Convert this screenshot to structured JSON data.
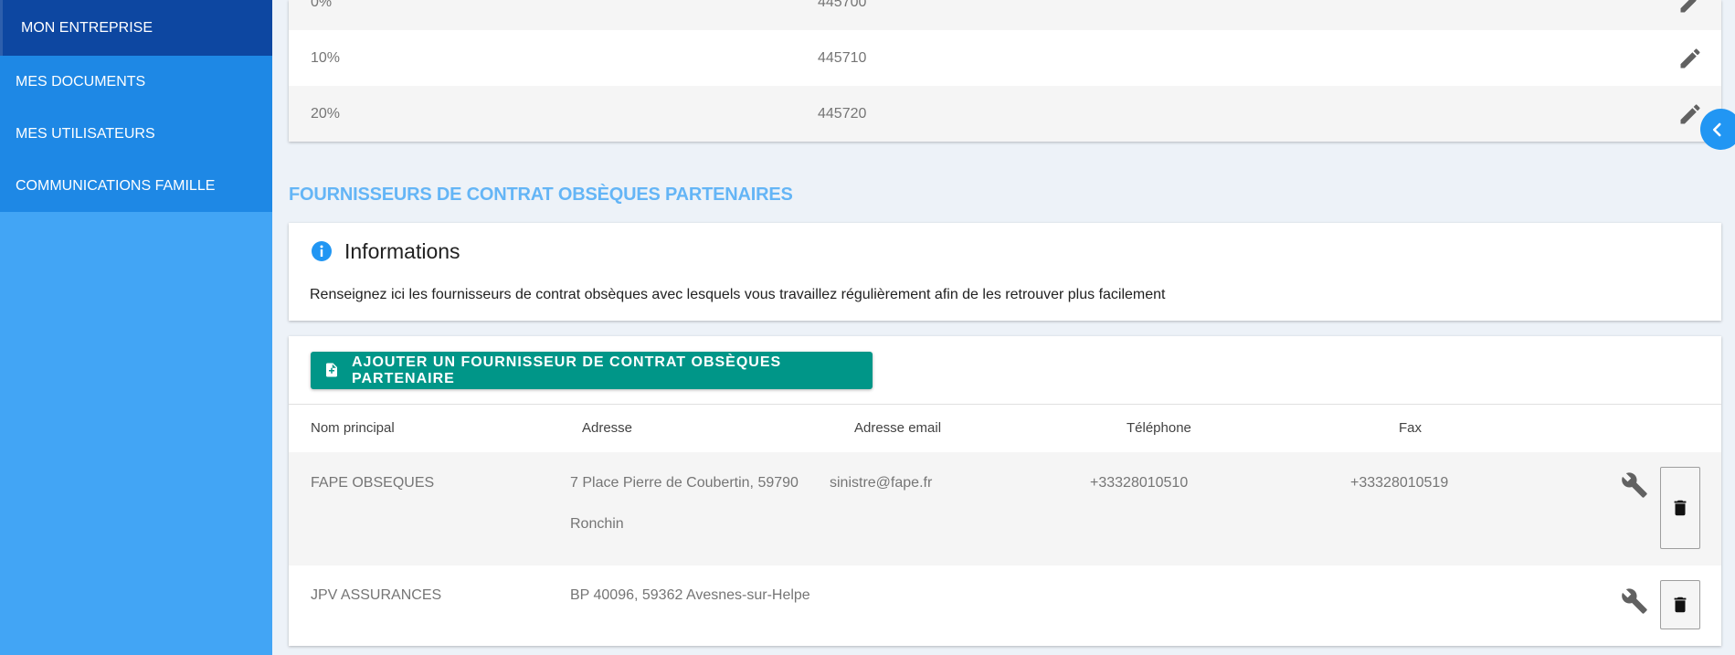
{
  "sidebar": {
    "items": [
      {
        "label": "MON ENTREPRISE"
      },
      {
        "label": "MES DOCUMENTS"
      },
      {
        "label": "MES UTILISATEURS"
      },
      {
        "label": "COMMUNICATIONS FAMILLE"
      }
    ]
  },
  "vat_table": {
    "rows": [
      {
        "rate": "0%",
        "account": "445700"
      },
      {
        "rate": "10%",
        "account": "445710"
      },
      {
        "rate": "20%",
        "account": "445720"
      }
    ]
  },
  "section": {
    "title": "FOURNISSEURS DE CONTRAT OBSÈQUES PARTENAIRES"
  },
  "info": {
    "title": "Informations",
    "text": "Renseignez ici les fournisseurs de contrat obsèques avec lesquels vous travaillez régulièrement afin de les retrouver plus facilement"
  },
  "providers": {
    "add_label": "AJOUTER UN FOURNISSEUR DE CONTRAT OBSÈQUES PARTENAIRE",
    "headers": {
      "name": "Nom principal",
      "address": "Adresse",
      "email": "Adresse email",
      "phone": "Téléphone",
      "fax": "Fax"
    },
    "rows": [
      {
        "name": "FAPE OBSEQUES",
        "address_line1": "7 Place Pierre de Coubertin, 59790",
        "address_line2": "Ronchin",
        "email": "sinistre@fape.fr",
        "phone": "+33328010510",
        "fax": "+33328010519"
      },
      {
        "name": "JPV ASSURANCES",
        "address_line1": "BP 40096, 59362 Avesnes-sur-Helpe",
        "address_line2": "",
        "email": "",
        "phone": "",
        "fax": ""
      }
    ]
  },
  "icons": {
    "edit": "pencil-icon",
    "info": "info-icon",
    "add": "file-plus-icon",
    "settings": "wrench-icon",
    "delete": "trash-icon",
    "collapse": "chevron-left-icon"
  },
  "colors": {
    "sidebar": "#42a5f5",
    "sidebar_menu": "#1e88e5",
    "sidebar_active": "#0d47a1",
    "section_title": "#64b5f6",
    "add_button": "#009688",
    "accent": "#2196f3"
  }
}
